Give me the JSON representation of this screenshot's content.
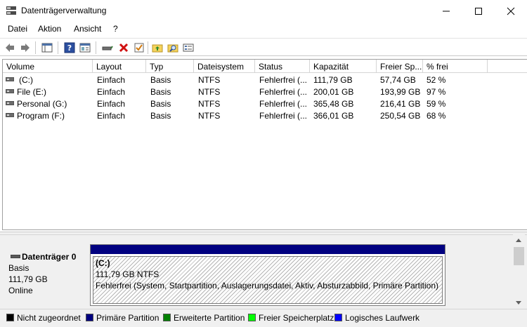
{
  "window": {
    "title": "Datenträgerverwaltung"
  },
  "menu": {
    "items": [
      "Datei",
      "Aktion",
      "Ansicht",
      "?"
    ]
  },
  "toolbar": {
    "icons": [
      "back-arrow-icon",
      "forward-arrow-icon",
      "console-tree-icon",
      "help-icon",
      "properties-view-icon",
      "connect-drive-icon",
      "delete-icon",
      "checklist-icon",
      "folder-up-icon",
      "search-folder-icon",
      "settings-panel-icon"
    ]
  },
  "volume_list": {
    "columns": [
      "Volume",
      "Layout",
      "Typ",
      "Dateisystem",
      "Status",
      "Kapazität",
      "Freier Sp...",
      "% frei"
    ],
    "rows": [
      {
        "volume": "(C:)",
        "layout": "Einfach",
        "typ": "Basis",
        "fs": "NTFS",
        "status": "Fehlerfrei (...",
        "capacity": "111,79 GB",
        "free": "57,74 GB",
        "pct": "52 %"
      },
      {
        "volume": "File (E:)",
        "layout": "Einfach",
        "typ": "Basis",
        "fs": "NTFS",
        "status": "Fehlerfrei (...",
        "capacity": "200,01 GB",
        "free": "193,99 GB",
        "pct": "97 %"
      },
      {
        "volume": "Personal (G:)",
        "layout": "Einfach",
        "typ": "Basis",
        "fs": "NTFS",
        "status": "Fehlerfrei (...",
        "capacity": "365,48 GB",
        "free": "216,41 GB",
        "pct": "59 %"
      },
      {
        "volume": "Program (F:)",
        "layout": "Einfach",
        "typ": "Basis",
        "fs": "NTFS",
        "status": "Fehlerfrei (...",
        "capacity": "366,01 GB",
        "free": "250,54 GB",
        "pct": "68 %"
      }
    ]
  },
  "disk": {
    "name": "Datenträger 0",
    "type": "Basis",
    "size": "111,79 GB",
    "state": "Online",
    "partition": {
      "title": "(C:)",
      "size_fs": "111,79 GB NTFS",
      "status": "Fehlerfrei (System, Startpartition, Auslagerungsdatei, Aktiv, Absturzabbild, Primäre Partition)",
      "color": "#000080"
    }
  },
  "legend": {
    "items": [
      {
        "label": "Nicht zugeordnet",
        "color": "#000000"
      },
      {
        "label": "Primäre Partition",
        "color": "#000080"
      },
      {
        "label": "Erweiterte Partition",
        "color": "#008000"
      },
      {
        "label": "Freier Speicherplatz",
        "color": "#00ff00"
      },
      {
        "label": "Logisches Laufwerk",
        "color": "#0000ff"
      }
    ]
  }
}
